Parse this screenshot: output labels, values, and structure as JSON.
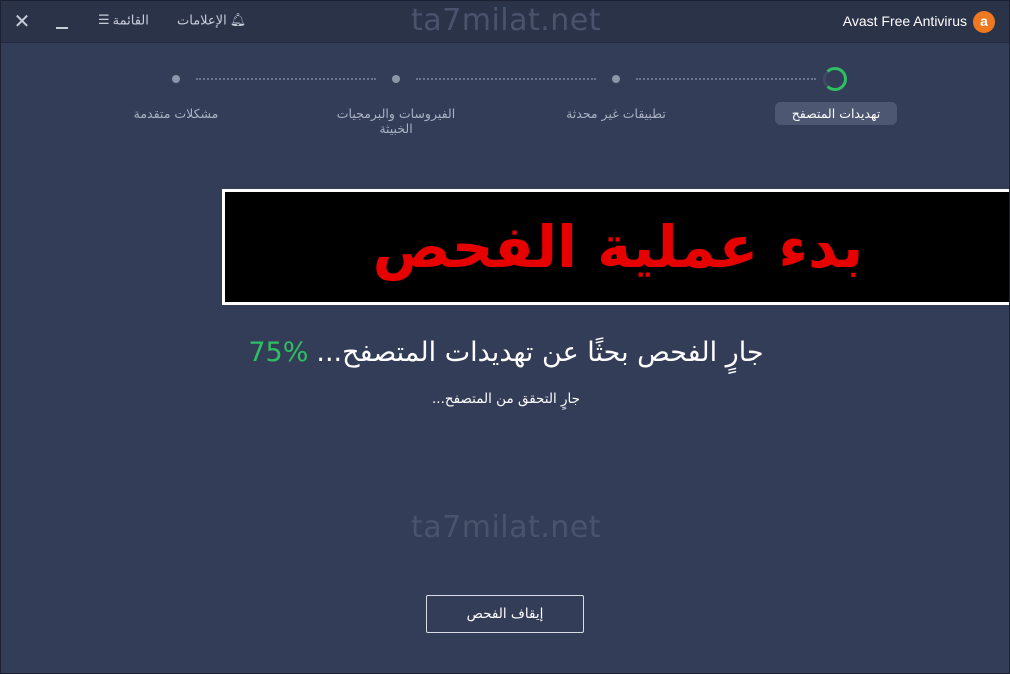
{
  "titlebar": {
    "app_name": "Avast Free Antivirus",
    "logo_letter": "a",
    "menu_label": "القائمة",
    "notifications_label": "الإعلامات",
    "close_glyph": "✕"
  },
  "watermark": "ta7milat.net",
  "steps": [
    {
      "label": "تهديدات المتصفح",
      "state": "active"
    },
    {
      "label": "تطبيقات غير محدثة",
      "state": "pending"
    },
    {
      "label_line1": "الفيروسات والبرمجيات",
      "label_line2": "الخبيثة",
      "state": "pending"
    },
    {
      "label": "مشكلات متقدمة",
      "state": "pending"
    }
  ],
  "banner": {
    "text": "بدء عملية الفحص"
  },
  "scan": {
    "message": "جارٍ الفحص بحثًا عن تهديدات المتصفح...",
    "percent": "75%",
    "progress_value": 75,
    "sub_status": "جارٍ التحقق من المتصفح..."
  },
  "actions": {
    "stop_label": "إيقاف الفحص"
  },
  "colors": {
    "background": "#343d58",
    "accent_green": "#2fbf63",
    "brand_orange": "#f07820",
    "banner_red": "#e60000"
  },
  "icons": {
    "close": "close-icon",
    "minimize": "minimize-icon",
    "menu": "hamburger-icon",
    "notifications": "bell-icon",
    "logo": "avast-logo-icon",
    "progress": "progress-ring-icon"
  }
}
